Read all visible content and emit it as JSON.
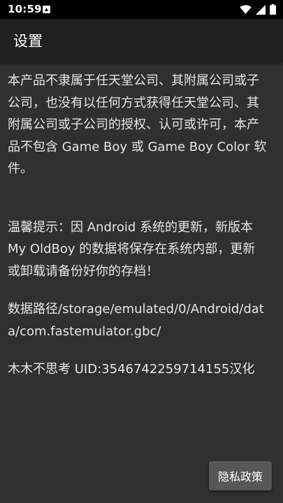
{
  "status_bar": {
    "time": "10:59"
  },
  "app_bar": {
    "title": "设置"
  },
  "content": {
    "paragraphs": [
      "本产品不隶属于任天堂公司、其附属公司或子公司，也没有以任何方式获得任天堂公司、其附属公司或子公司的授权、认可或许可，本产品不包含 Game Boy 或 Game Boy Color 软件。",
      "温馨提示：因 Android 系统的更新，新版本 My OldBoy 的数据将保存在系统内部，更新或卸载请备份好你的存档！",
      "数据路径/storage/emulated/0/Android/data/com.fastemulator.gbc/",
      "木木不思考 UID:3546742259714155汉化"
    ]
  },
  "buttons": {
    "privacy_label": "隐私政策"
  }
}
